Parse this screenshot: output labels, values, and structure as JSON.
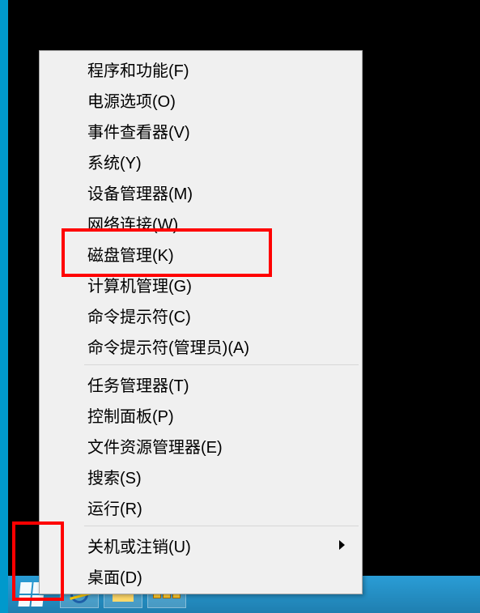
{
  "menu": {
    "groups": [
      [
        {
          "id": "programs-features",
          "label": "程序和功能(F)",
          "submenu": false
        },
        {
          "id": "power-options",
          "label": "电源选项(O)",
          "submenu": false
        },
        {
          "id": "event-viewer",
          "label": "事件查看器(V)",
          "submenu": false
        },
        {
          "id": "system",
          "label": "系统(Y)",
          "submenu": false
        },
        {
          "id": "device-manager",
          "label": "设备管理器(M)",
          "submenu": false
        },
        {
          "id": "network-connections",
          "label": "网络连接(W)",
          "submenu": false
        },
        {
          "id": "disk-management",
          "label": "磁盘管理(K)",
          "submenu": false
        },
        {
          "id": "computer-management",
          "label": "计算机管理(G)",
          "submenu": false
        },
        {
          "id": "command-prompt",
          "label": "命令提示符(C)",
          "submenu": false
        },
        {
          "id": "command-prompt-admin",
          "label": "命令提示符(管理员)(A)",
          "submenu": false
        }
      ],
      [
        {
          "id": "task-manager",
          "label": "任务管理器(T)",
          "submenu": false
        },
        {
          "id": "control-panel",
          "label": "控制面板(P)",
          "submenu": false
        },
        {
          "id": "file-explorer",
          "label": "文件资源管理器(E)",
          "submenu": false
        },
        {
          "id": "search",
          "label": "搜索(S)",
          "submenu": false
        },
        {
          "id": "run",
          "label": "运行(R)",
          "submenu": false
        }
      ],
      [
        {
          "id": "shutdown-signout",
          "label": "关机或注销(U)",
          "submenu": true
        },
        {
          "id": "desktop",
          "label": "桌面(D)",
          "submenu": false
        }
      ]
    ]
  },
  "highlights": {
    "box1_target": "disk-management",
    "box2_target": "start-button"
  },
  "taskbar": {
    "items": [
      "start",
      "ie",
      "explorer",
      "settings"
    ]
  }
}
